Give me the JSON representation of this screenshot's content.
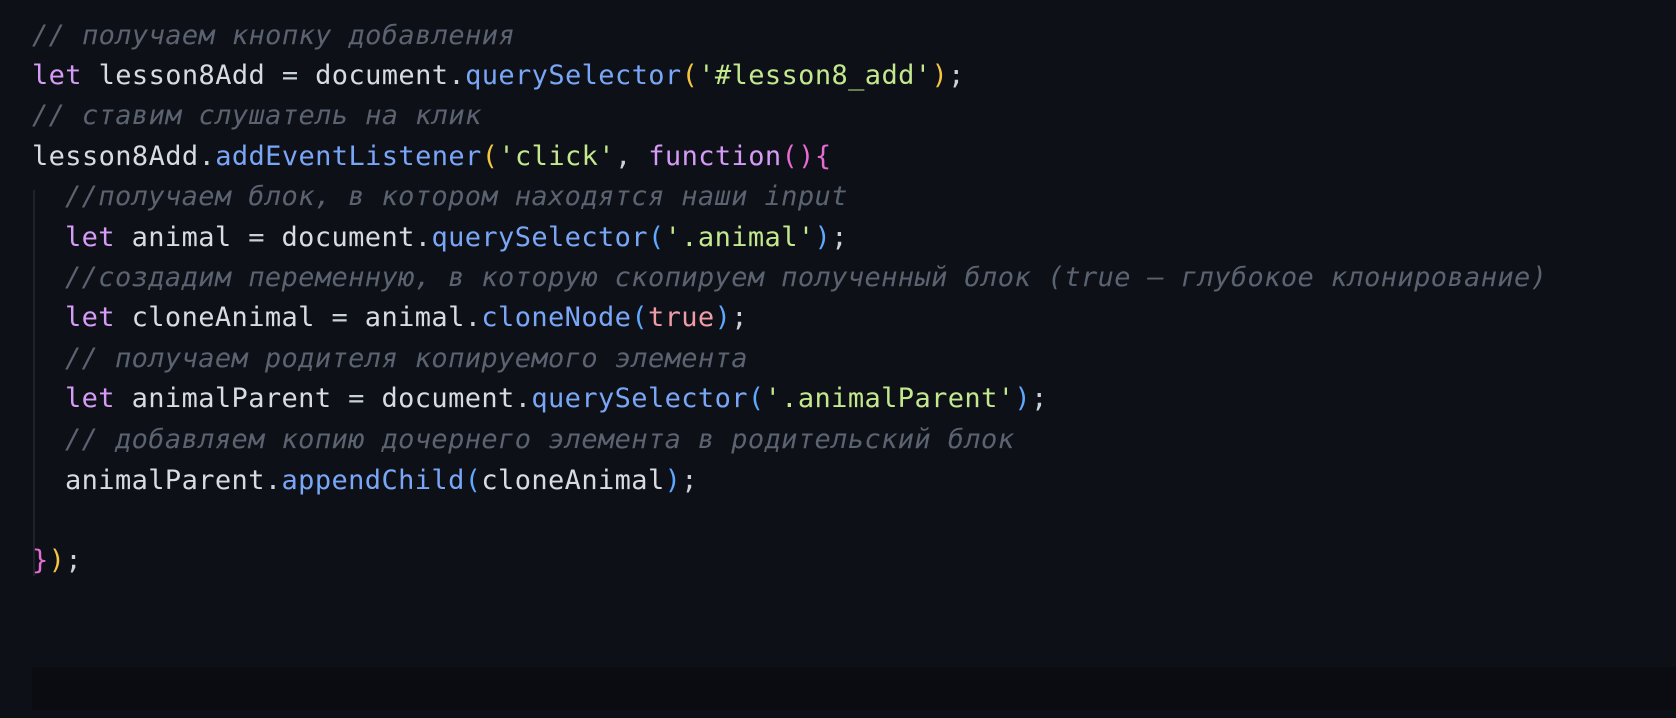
{
  "lines": [
    {
      "indent": false,
      "tokens": [
        {
          "t": "// получаем кнопку добавления",
          "c": "cm"
        }
      ]
    },
    {
      "indent": false,
      "tokens": [
        {
          "t": "let",
          "c": "kw"
        },
        {
          "t": " lesson8Add ",
          "c": "id"
        },
        {
          "t": "=",
          "c": "pu"
        },
        {
          "t": " document",
          "c": "id"
        },
        {
          "t": ".",
          "c": "pu"
        },
        {
          "t": "querySelector",
          "c": "fn"
        },
        {
          "t": "(",
          "c": "br1"
        },
        {
          "t": "'#lesson8_add'",
          "c": "str"
        },
        {
          "t": ")",
          "c": "br1"
        },
        {
          "t": ";",
          "c": "pu"
        }
      ]
    },
    {
      "indent": false,
      "tokens": [
        {
          "t": "// ставим слушатель на клик",
          "c": "cm"
        }
      ]
    },
    {
      "indent": false,
      "tokens": [
        {
          "t": "lesson8Add",
          "c": "id"
        },
        {
          "t": ".",
          "c": "pu"
        },
        {
          "t": "addEventListener",
          "c": "fn"
        },
        {
          "t": "(",
          "c": "br1"
        },
        {
          "t": "'click'",
          "c": "str"
        },
        {
          "t": ", ",
          "c": "pu"
        },
        {
          "t": "function",
          "c": "kw"
        },
        {
          "t": "()",
          "c": "br2"
        },
        {
          "t": "{",
          "c": "br2"
        }
      ]
    },
    {
      "indent": true,
      "tokens": [
        {
          "t": "//получаем блок, в котором находятся наши input",
          "c": "cm"
        }
      ]
    },
    {
      "indent": true,
      "tokens": [
        {
          "t": "let",
          "c": "kw"
        },
        {
          "t": " animal ",
          "c": "id"
        },
        {
          "t": "=",
          "c": "pu"
        },
        {
          "t": " document",
          "c": "id"
        },
        {
          "t": ".",
          "c": "pu"
        },
        {
          "t": "querySelector",
          "c": "fn"
        },
        {
          "t": "(",
          "c": "br3"
        },
        {
          "t": "'.animal'",
          "c": "str"
        },
        {
          "t": ")",
          "c": "br3"
        },
        {
          "t": ";",
          "c": "pu"
        }
      ]
    },
    {
      "indent": true,
      "tokens": [
        {
          "t": "//создадим переменную, в которую скопируем полученный блок (true — глубокое клонирование)",
          "c": "cm"
        }
      ]
    },
    {
      "indent": true,
      "tokens": [
        {
          "t": "let",
          "c": "kw"
        },
        {
          "t": " cloneAnimal ",
          "c": "id"
        },
        {
          "t": "=",
          "c": "pu"
        },
        {
          "t": " animal",
          "c": "id"
        },
        {
          "t": ".",
          "c": "pu"
        },
        {
          "t": "cloneNode",
          "c": "fn"
        },
        {
          "t": "(",
          "c": "br3"
        },
        {
          "t": "true",
          "c": "bool"
        },
        {
          "t": ")",
          "c": "br3"
        },
        {
          "t": ";",
          "c": "pu"
        }
      ]
    },
    {
      "indent": true,
      "tokens": [
        {
          "t": "// получаем родителя копируемого элемента",
          "c": "cm"
        }
      ]
    },
    {
      "indent": true,
      "tokens": [
        {
          "t": "let",
          "c": "kw"
        },
        {
          "t": " animalParent ",
          "c": "id"
        },
        {
          "t": "=",
          "c": "pu"
        },
        {
          "t": " document",
          "c": "id"
        },
        {
          "t": ".",
          "c": "pu"
        },
        {
          "t": "querySelector",
          "c": "fn"
        },
        {
          "t": "(",
          "c": "br3"
        },
        {
          "t": "'.animalParent'",
          "c": "str"
        },
        {
          "t": ")",
          "c": "br3"
        },
        {
          "t": ";",
          "c": "pu"
        }
      ]
    },
    {
      "indent": true,
      "tokens": [
        {
          "t": "// добавляем копию дочернего элемента в родительский блок",
          "c": "cm"
        }
      ]
    },
    {
      "indent": true,
      "tokens": [
        {
          "t": "animalParent",
          "c": "id"
        },
        {
          "t": ".",
          "c": "pu"
        },
        {
          "t": "appendChild",
          "c": "fn"
        },
        {
          "t": "(",
          "c": "br3"
        },
        {
          "t": "cloneAnimal",
          "c": "id"
        },
        {
          "t": ")",
          "c": "br3"
        },
        {
          "t": ";",
          "c": "pu"
        }
      ]
    },
    {
      "indent": true,
      "tokens": []
    },
    {
      "indent": false,
      "tokens": [
        {
          "t": "}",
          "c": "br2"
        },
        {
          "t": ")",
          "c": "br1"
        },
        {
          "t": ";",
          "c": "pu"
        }
      ]
    }
  ],
  "colors": {
    "background": "#0d1017",
    "comment": "#5b6270",
    "keyword": "#d59bf6",
    "function": "#7aa6f7",
    "string": "#c3e88d",
    "boolean": "#f09ba8",
    "bracket_level1": "#f5c542",
    "bracket_level2": "#e66bd2",
    "bracket_level3": "#5fa8ff"
  }
}
